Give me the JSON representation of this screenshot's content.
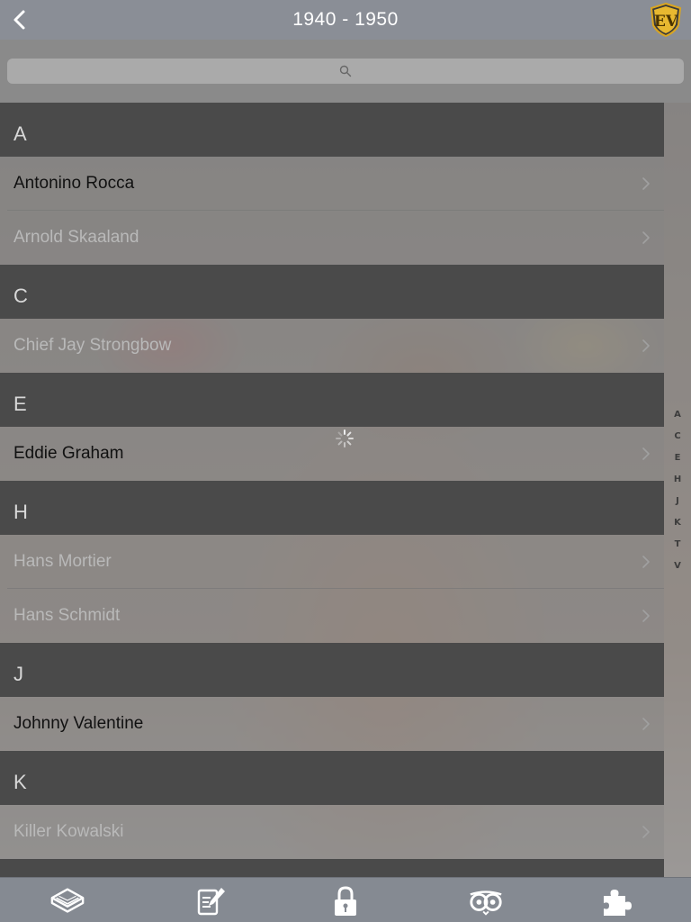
{
  "header": {
    "title": "1940 - 1950",
    "back_icon": "chevron-left-icon",
    "logo_text": "EV"
  },
  "search": {
    "placeholder": "",
    "icon": "search-icon"
  },
  "sections": [
    {
      "letter": "A",
      "items": [
        {
          "name": "Antonino Rocca",
          "bright": true
        },
        {
          "name": "Arnold Skaaland",
          "bright": false
        }
      ]
    },
    {
      "letter": "C",
      "items": [
        {
          "name": "Chief Jay Strongbow",
          "bright": false
        }
      ]
    },
    {
      "letter": "E",
      "items": [
        {
          "name": "Eddie Graham",
          "bright": true
        }
      ]
    },
    {
      "letter": "H",
      "items": [
        {
          "name": "Hans Mortier",
          "bright": false
        },
        {
          "name": "Hans Schmidt",
          "bright": false
        }
      ]
    },
    {
      "letter": "J",
      "items": [
        {
          "name": "Johnny Valentine",
          "bright": true
        }
      ]
    },
    {
      "letter": "K",
      "items": [
        {
          "name": "Killer Kowalski",
          "bright": false
        }
      ]
    }
  ],
  "index": [
    "A",
    "C",
    "E",
    "H",
    "J",
    "K",
    "T",
    "V"
  ],
  "tabs": [
    {
      "icon": "wrestling-ring-icon"
    },
    {
      "icon": "notepad-edit-icon"
    },
    {
      "icon": "padlock-icon"
    },
    {
      "icon": "owl-icon"
    },
    {
      "icon": "puzzle-piece-icon"
    }
  ],
  "colors": {
    "navbar": "#8a8e96",
    "section_header": "#4a4a4a",
    "tabbar": "#858a92",
    "logo_gold": "#d9a520"
  }
}
